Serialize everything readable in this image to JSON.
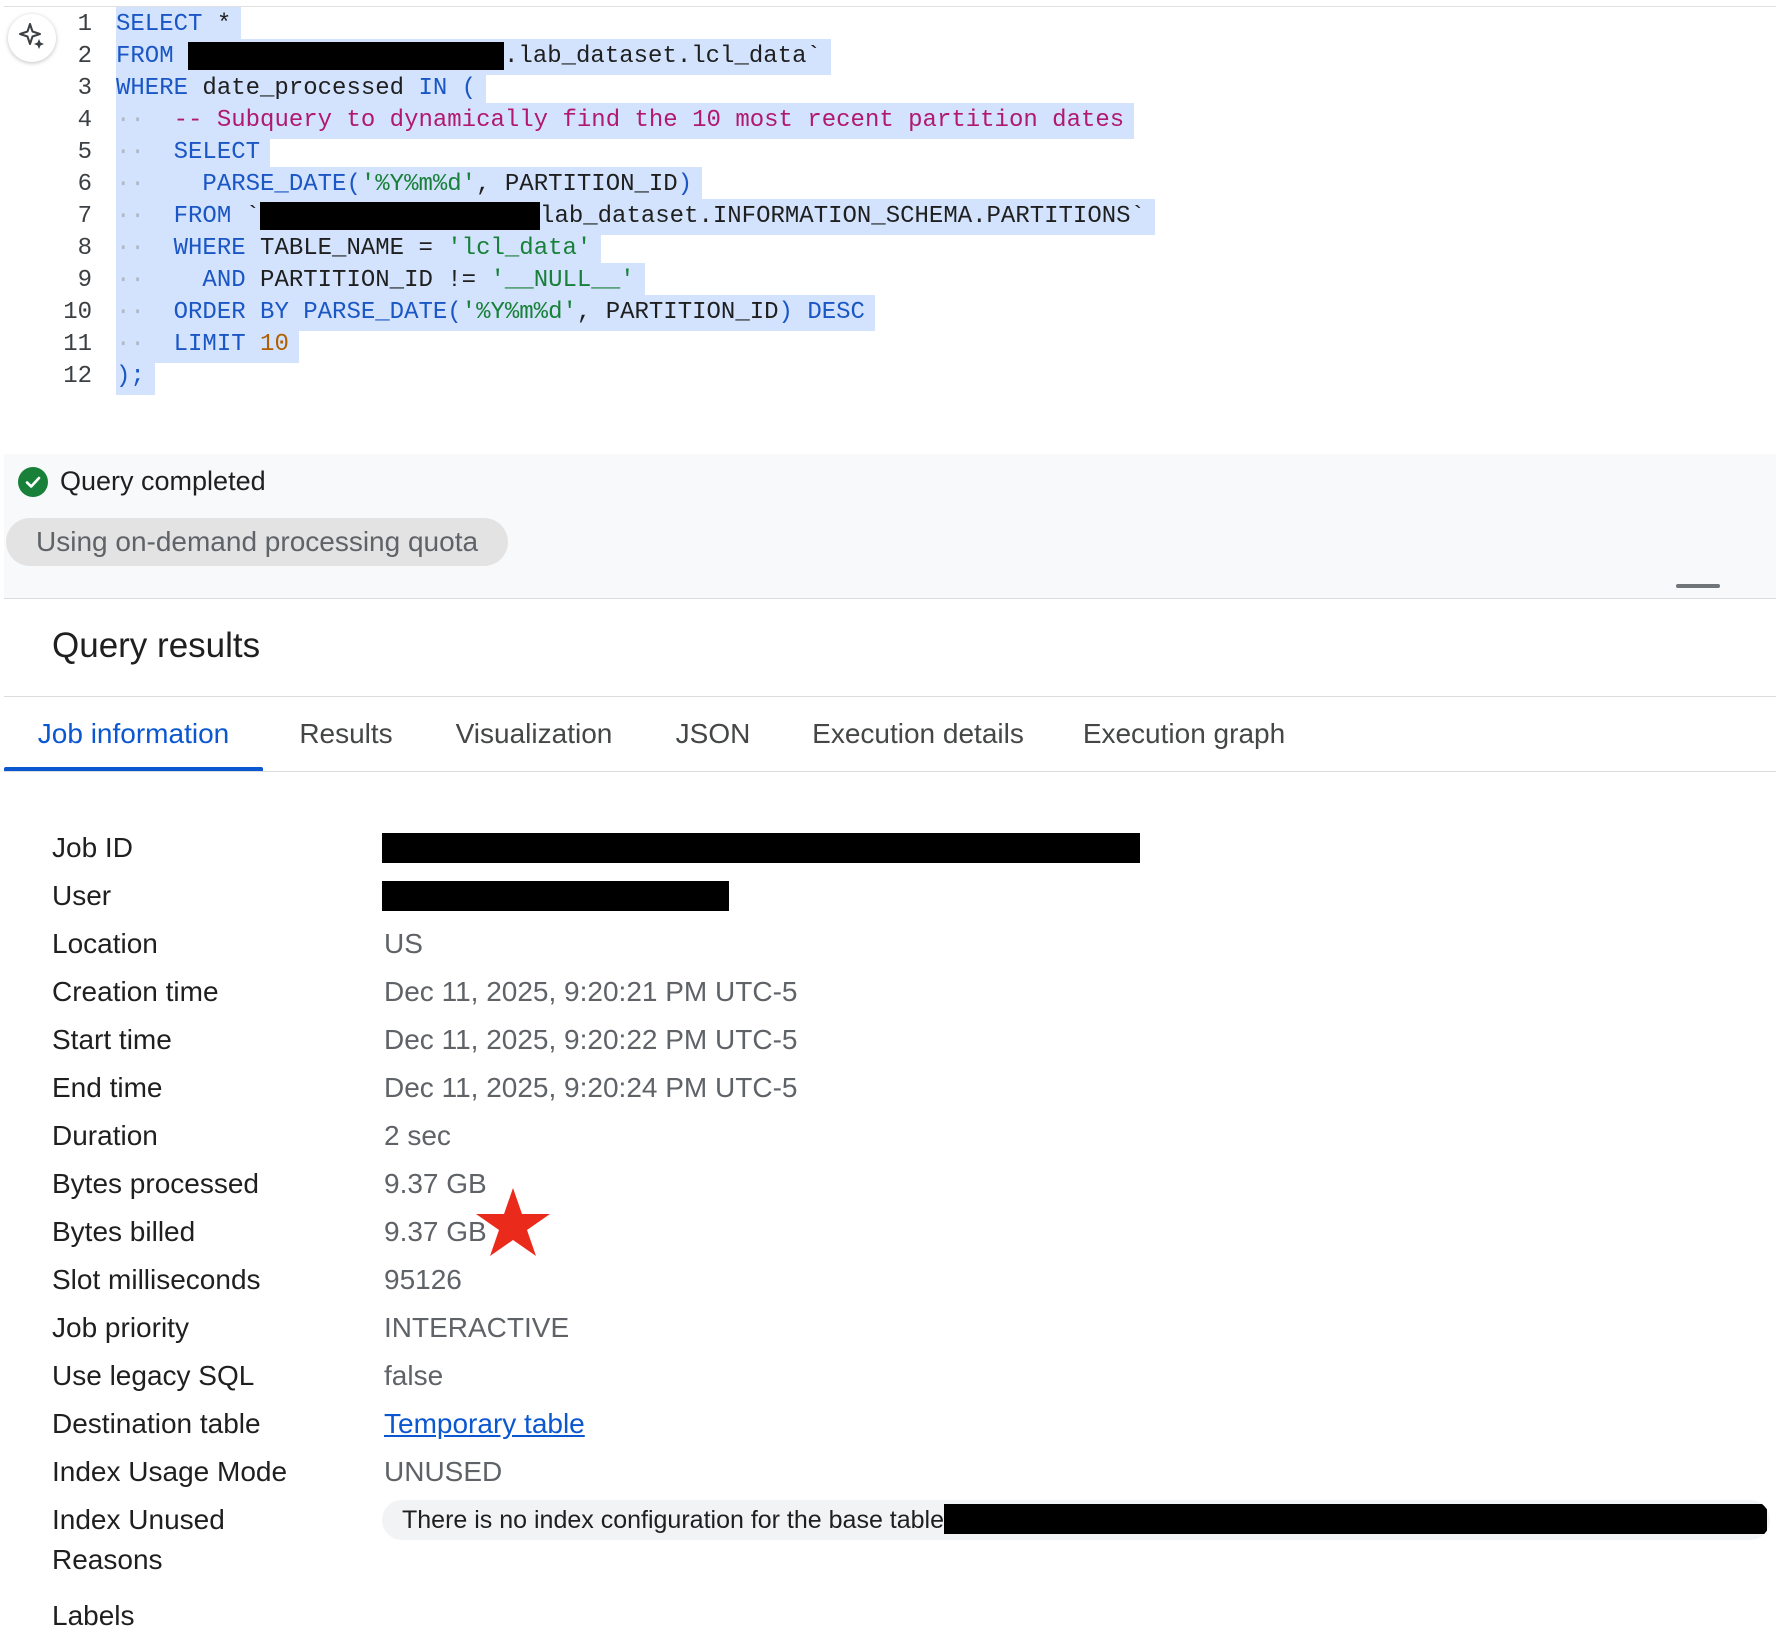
{
  "editor": {
    "line_numbers": [
      "1",
      "2",
      "3",
      "4",
      "5",
      "6",
      "7",
      "8",
      "9",
      "10",
      "11",
      "12"
    ],
    "lines": {
      "l1_kw": "SELECT",
      "l1_rest": " *",
      "l2_kw": "FROM",
      "l2_rest": ".lab_dataset.lcl_data`",
      "l3_kw1": "WHERE",
      "l3_mid": " date_processed ",
      "l3_kw2": "IN (",
      "l4_comment": "-- Subquery to dynamically find the 10 most recent partition dates",
      "l5_kw": "SELECT",
      "l6_fn": "PARSE_DATE(",
      "l6_str": "'%Y%m%d'",
      "l6_rest": ", PARTITION_ID",
      "l6_close": ")",
      "l7_kw": "FROM",
      "l7_tick": " `",
      "l7_rest": "lab_dataset.INFORMATION_SCHEMA.PARTITIONS`",
      "l8_kw": "WHERE",
      "l8_mid": " TABLE_NAME = ",
      "l8_str": "'lcl_data'",
      "l9_kw": "AND",
      "l9_mid": " PARTITION_ID != ",
      "l9_str": "'__NULL__'",
      "l10_kw": "ORDER BY PARSE_DATE(",
      "l10_str": "'%Y%m%d'",
      "l10_mid": ", PARTITION_ID",
      "l10_kw2": ") DESC",
      "l11_kw": "LIMIT",
      "l11_num": "10",
      "l12": ");"
    }
  },
  "status": {
    "text": "Query completed",
    "quota_chip": "Using on-demand processing quota"
  },
  "results": {
    "title": "Query results",
    "tabs": [
      "Job information",
      "Results",
      "Visualization",
      "JSON",
      "Execution details",
      "Execution graph"
    ],
    "active_tab": "Job information"
  },
  "job_info": {
    "job_id_label": "Job ID",
    "user_label": "User",
    "location_label": "Location",
    "location": "US",
    "creation_time_label": "Creation time",
    "creation_time": "Dec 11, 2025, 9:20:21 PM UTC-5",
    "start_time_label": "Start time",
    "start_time": "Dec 11, 2025, 9:20:22 PM UTC-5",
    "end_time_label": "End time",
    "end_time": "Dec 11, 2025, 9:20:24 PM UTC-5",
    "duration_label": "Duration",
    "duration": "2 sec",
    "bytes_processed_label": "Bytes processed",
    "bytes_processed": "9.37 GB",
    "bytes_billed_label": "Bytes billed",
    "bytes_billed": "9.37 GB",
    "slot_ms_label": "Slot milliseconds",
    "slot_ms": "95126",
    "job_priority_label": "Job priority",
    "job_priority": "INTERACTIVE",
    "legacy_sql_label": "Use legacy SQL",
    "legacy_sql": "false",
    "destination_label": "Destination table",
    "destination": "Temporary table",
    "index_mode_label": "Index Usage Mode",
    "index_mode": "UNUSED",
    "index_unused_label_1": "Index Unused",
    "index_unused_label_2": "Reasons",
    "index_unused_reason": "There is no index configuration for the base table",
    "labels_label": "Labels"
  },
  "colors": {
    "accent": "#0b57d0",
    "selection": "#d3e3fd",
    "success": "#188038",
    "star": "#ea2a1a"
  }
}
